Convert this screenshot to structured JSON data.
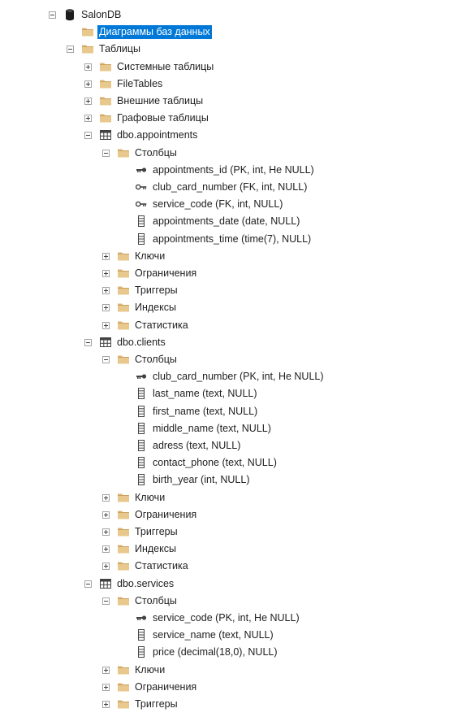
{
  "tree": [
    {
      "depth": 0,
      "expander": "minus",
      "icon": "database-icon",
      "label": "SalonDB"
    },
    {
      "depth": 1,
      "expander": "none",
      "icon": "folder-icon",
      "label": "Диаграммы баз данных",
      "selected": true
    },
    {
      "depth": 1,
      "expander": "minus",
      "icon": "folder-icon",
      "label": "Таблицы"
    },
    {
      "depth": 2,
      "expander": "plus",
      "icon": "folder-icon",
      "label": "Системные таблицы"
    },
    {
      "depth": 2,
      "expander": "plus",
      "icon": "folder-icon",
      "label": "FileTables"
    },
    {
      "depth": 2,
      "expander": "plus",
      "icon": "folder-icon",
      "label": "Внешние таблицы"
    },
    {
      "depth": 2,
      "expander": "plus",
      "icon": "folder-icon",
      "label": "Графовые таблицы"
    },
    {
      "depth": 2,
      "expander": "minus",
      "icon": "table-icon",
      "label": "dbo.appointments"
    },
    {
      "depth": 3,
      "expander": "minus",
      "icon": "folder-icon",
      "label": "Столбцы"
    },
    {
      "depth": 4,
      "expander": "none",
      "icon": "primary-key-icon",
      "label": "appointments_id (PK, int, He NULL)"
    },
    {
      "depth": 4,
      "expander": "none",
      "icon": "foreign-key-icon",
      "label": "club_card_number (FK, int, NULL)"
    },
    {
      "depth": 4,
      "expander": "none",
      "icon": "foreign-key-icon",
      "label": "service_code (FK, int, NULL)"
    },
    {
      "depth": 4,
      "expander": "none",
      "icon": "column-icon",
      "label": "appointments_date (date, NULL)"
    },
    {
      "depth": 4,
      "expander": "none",
      "icon": "column-icon",
      "label": "appointments_time (time(7), NULL)"
    },
    {
      "depth": 3,
      "expander": "plus",
      "icon": "folder-icon",
      "label": "Ключи"
    },
    {
      "depth": 3,
      "expander": "plus",
      "icon": "folder-icon",
      "label": "Ограничения"
    },
    {
      "depth": 3,
      "expander": "plus",
      "icon": "folder-icon",
      "label": "Триггеры"
    },
    {
      "depth": 3,
      "expander": "plus",
      "icon": "folder-icon",
      "label": "Индексы"
    },
    {
      "depth": 3,
      "expander": "plus",
      "icon": "folder-icon",
      "label": "Статистика"
    },
    {
      "depth": 2,
      "expander": "minus",
      "icon": "table-icon",
      "label": "dbo.clients"
    },
    {
      "depth": 3,
      "expander": "minus",
      "icon": "folder-icon",
      "label": "Столбцы"
    },
    {
      "depth": 4,
      "expander": "none",
      "icon": "primary-key-icon",
      "label": "club_card_number (PK, int, He NULL)"
    },
    {
      "depth": 4,
      "expander": "none",
      "icon": "column-icon",
      "label": "last_name (text, NULL)"
    },
    {
      "depth": 4,
      "expander": "none",
      "icon": "column-icon",
      "label": "first_name (text, NULL)"
    },
    {
      "depth": 4,
      "expander": "none",
      "icon": "column-icon",
      "label": "middle_name (text, NULL)"
    },
    {
      "depth": 4,
      "expander": "none",
      "icon": "column-icon",
      "label": "adress (text, NULL)"
    },
    {
      "depth": 4,
      "expander": "none",
      "icon": "column-icon",
      "label": "contact_phone (text, NULL)"
    },
    {
      "depth": 4,
      "expander": "none",
      "icon": "column-icon",
      "label": "birth_year (int, NULL)"
    },
    {
      "depth": 3,
      "expander": "plus",
      "icon": "folder-icon",
      "label": "Ключи"
    },
    {
      "depth": 3,
      "expander": "plus",
      "icon": "folder-icon",
      "label": "Ограничения"
    },
    {
      "depth": 3,
      "expander": "plus",
      "icon": "folder-icon",
      "label": "Триггеры"
    },
    {
      "depth": 3,
      "expander": "plus",
      "icon": "folder-icon",
      "label": "Индексы"
    },
    {
      "depth": 3,
      "expander": "plus",
      "icon": "folder-icon",
      "label": "Статистика"
    },
    {
      "depth": 2,
      "expander": "minus",
      "icon": "table-icon",
      "label": "dbo.services"
    },
    {
      "depth": 3,
      "expander": "minus",
      "icon": "folder-icon",
      "label": "Столбцы"
    },
    {
      "depth": 4,
      "expander": "none",
      "icon": "primary-key-icon",
      "label": "service_code (PK, int, He NULL)"
    },
    {
      "depth": 4,
      "expander": "none",
      "icon": "column-icon",
      "label": "service_name (text, NULL)"
    },
    {
      "depth": 4,
      "expander": "none",
      "icon": "column-icon",
      "label": "price (decimal(18,0), NULL)"
    },
    {
      "depth": 3,
      "expander": "plus",
      "icon": "folder-icon",
      "label": "Ключи"
    },
    {
      "depth": 3,
      "expander": "plus",
      "icon": "folder-icon",
      "label": "Ограничения"
    },
    {
      "depth": 3,
      "expander": "plus",
      "icon": "folder-icon",
      "label": "Триггеры"
    }
  ],
  "colors": {
    "folder": "#dcb67a",
    "folder_dark": "#c49a54",
    "selection": "#0078d7",
    "icon_stroke": "#424242"
  }
}
